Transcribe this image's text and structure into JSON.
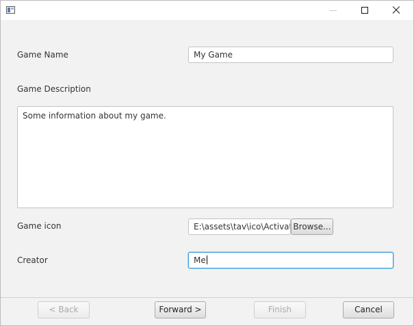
{
  "window": {
    "icon": "app-window-icon",
    "controls": {
      "minimize": "minimize-icon",
      "maximize": "maximize-icon",
      "close": "close-icon"
    }
  },
  "form": {
    "game_name": {
      "label": "Game Name",
      "value": "My Game"
    },
    "game_description": {
      "label": "Game Description",
      "value": "Some information about my game."
    },
    "game_icon": {
      "label": "Game icon",
      "value": "E:\\assets\\tav\\ico\\Activate.",
      "browse_label": "Browse..."
    },
    "creator": {
      "label": "Creator",
      "value": "Me"
    }
  },
  "footer": {
    "back_label": "< Back",
    "forward_label": "Forward >",
    "finish_label": "Finish",
    "cancel_label": "Cancel",
    "back_enabled": false,
    "finish_enabled": false
  },
  "colors": {
    "focus": "#3a9bdc",
    "background": "#f2f2f2",
    "disabled_text": "#aaaaaa"
  }
}
